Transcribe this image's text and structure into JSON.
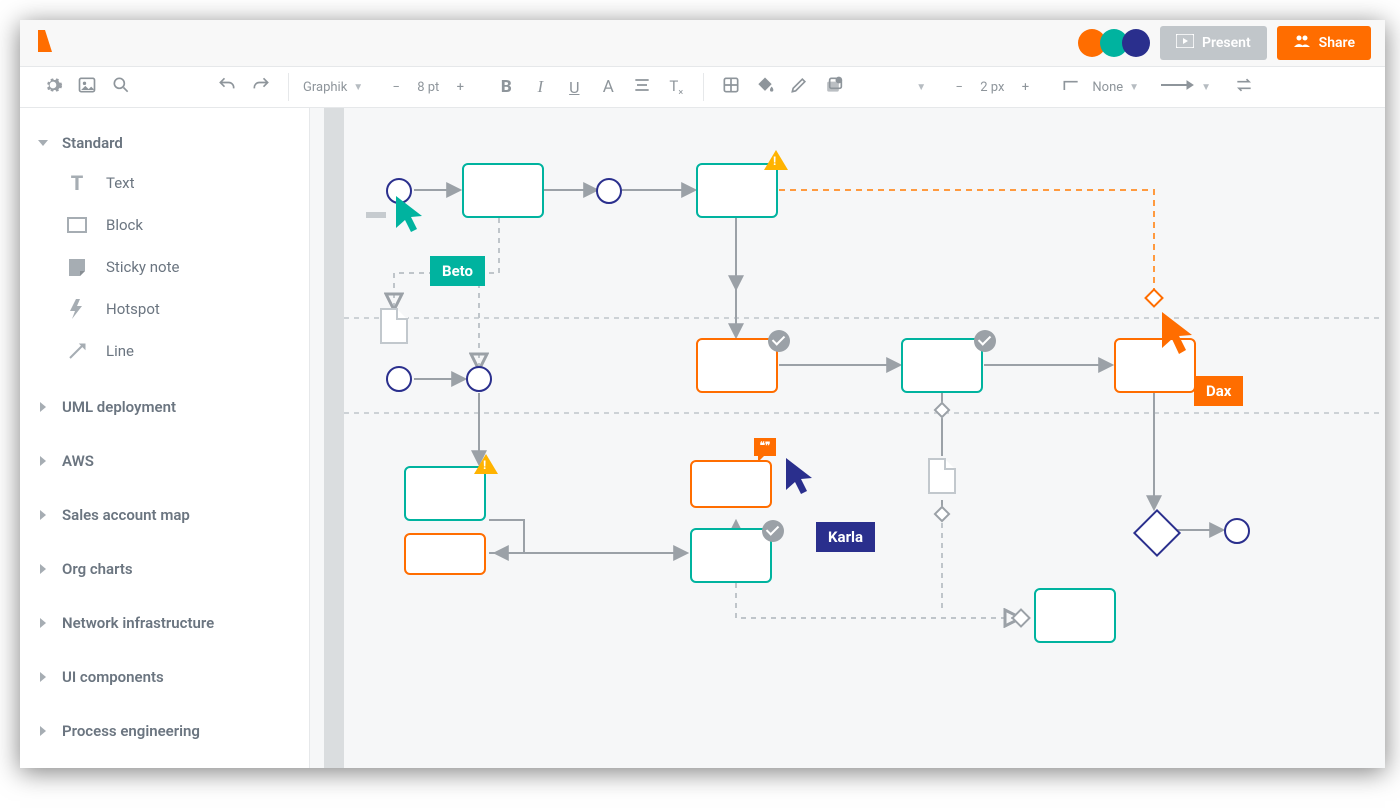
{
  "header": {
    "present_label": "Present",
    "share_label": "Share",
    "presence_colors": [
      "#ff6d00",
      "#00b39f",
      "#2a2f8d"
    ]
  },
  "toolbar": {
    "font_family": "Graphik",
    "font_size": "8 pt",
    "stroke_width": "2 px",
    "line_style": "None"
  },
  "sidebar": {
    "libraries": [
      {
        "name": "Standard",
        "expanded": true,
        "items": [
          {
            "label": "Text",
            "icon": "text-icon"
          },
          {
            "label": "Block",
            "icon": "block-icon"
          },
          {
            "label": "Sticky note",
            "icon": "sticky-note-icon"
          },
          {
            "label": "Hotspot",
            "icon": "hotspot-icon"
          },
          {
            "label": "Line",
            "icon": "line-icon"
          }
        ]
      },
      {
        "name": "UML deployment",
        "expanded": false
      },
      {
        "name": "AWS",
        "expanded": false
      },
      {
        "name": "Sales account map",
        "expanded": false
      },
      {
        "name": "Org charts",
        "expanded": false
      },
      {
        "name": "Network infrastructure",
        "expanded": false
      },
      {
        "name": "UI components",
        "expanded": false
      },
      {
        "name": "Process engineering",
        "expanded": false
      }
    ]
  },
  "collaborators": [
    {
      "name": "Beto",
      "color": "#00b39f"
    },
    {
      "name": "Karla",
      "color": "#2a2f8d"
    },
    {
      "name": "Dax",
      "color": "#ff6d00"
    }
  ],
  "colors": {
    "teal": "#00b39f",
    "orange": "#ff6d00",
    "indigo": "#2a2f8d",
    "grey": "#9ba1a7",
    "amber": "#ffb300"
  }
}
